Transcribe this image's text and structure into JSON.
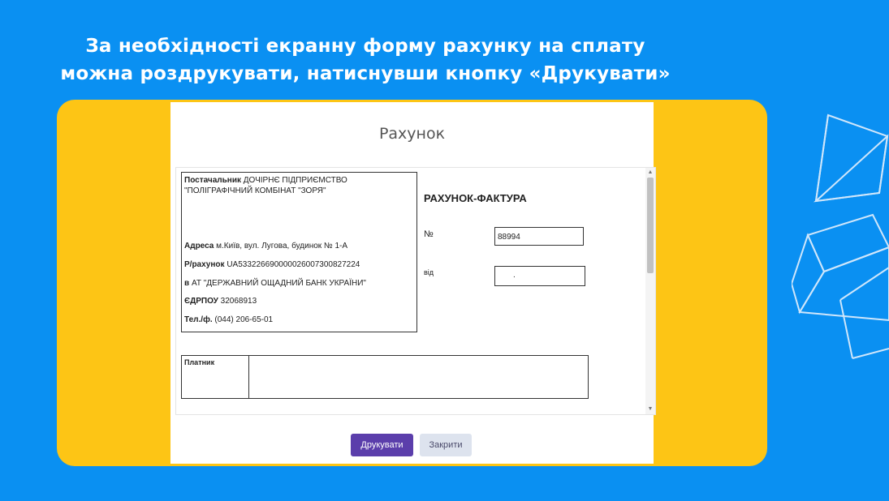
{
  "slide": {
    "heading_line1": "За необхідності екранну форму рахунку на сплату",
    "heading_line2": "можна роздрукувати, натиснувши кнопку «Друкувати»"
  },
  "dialog": {
    "title": "Рахунок",
    "supplier": {
      "supplier_label": "Постачальник",
      "supplier_value": "ДОЧІРНЄ ПІДПРИЄМСТВО \"ПОЛІГРАФІЧНИЙ КОМБІНАТ \"ЗОРЯ\"",
      "address_label": "Адреса",
      "address_value": "м.Київ, вул. Лугова, будинок № 1-А",
      "account_label": "Р/рахунок",
      "account_value": "UA533226690000026007300827224",
      "bank_label": "в",
      "bank_value": "АТ \"ДЕРЖАВНИЙ ОЩАДНИЙ БАНК УКРАЇНИ\"",
      "edrpou_label": "ЄДРПОУ",
      "edrpou_value": "32068913",
      "phone_label": "Тел./ф.",
      "phone_value": "(044) 206-65-01"
    },
    "invoice": {
      "title": "РАХУНОК-ФАКТУРА",
      "number_label": "№",
      "number_value": "88994",
      "date_label": "від",
      "date_value": "."
    },
    "payer_label": "Платник",
    "buttons": {
      "print": "Друкувати",
      "close": "Закрити"
    }
  },
  "colors": {
    "background": "#0a90f2",
    "panel": "#fdc515",
    "print_button": "#5b3eab",
    "close_button": "#dde3ee"
  }
}
